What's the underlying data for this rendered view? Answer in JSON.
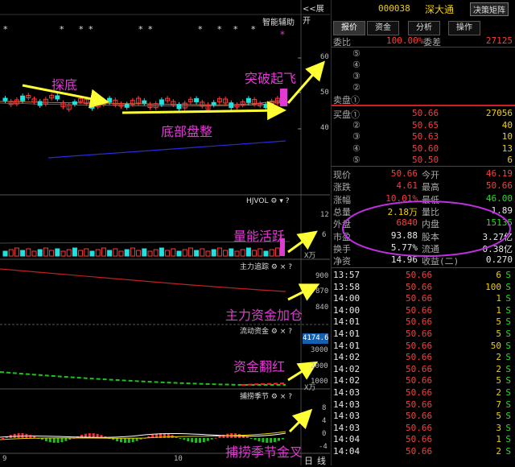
{
  "top_bar": {
    "expand_label": "<<展开",
    "code": "000038",
    "name": "深大通",
    "decision_button": "决策矩阵"
  },
  "main_chart": {
    "indicator_label": "智能辅助",
    "stars": [
      "*",
      "*",
      "*",
      "*",
      "*",
      "*",
      "*",
      "*",
      "*",
      "*"
    ],
    "price_ticks": [
      "60",
      "50",
      "40"
    ],
    "annotations": {
      "bottom_touch": "探底",
      "breakout": "突破起飞",
      "consolidation": "底部盘整"
    }
  },
  "volume_panel": {
    "title": "HJVOL",
    "ticks": [
      "12",
      "6",
      "X万"
    ],
    "annotation": "量能活跃"
  },
  "capital_panel": {
    "title": "主力追踪",
    "ticks": [
      "900",
      "870",
      "840"
    ],
    "annotation": "主力资金加仓"
  },
  "flow_panel": {
    "title": "流动资金",
    "value_box": "4174.6",
    "ticks": [
      "3000",
      "2000",
      "1000",
      "X万"
    ],
    "annotation": "资金翻红"
  },
  "season_panel": {
    "title": "捕捞季节",
    "ticks": [
      "8",
      "4",
      "0",
      "-4"
    ],
    "annotation": "捕捞季节金叉"
  },
  "x_axis": {
    "labels": [
      "9",
      "10"
    ],
    "period": "日",
    "line": "线"
  },
  "panel_icons": {
    "gear": "⚙",
    "down": "▾",
    "help": "?",
    "close": "×"
  },
  "tabs": [
    "报价",
    "资金",
    "分析",
    "操作"
  ],
  "order_book": {
    "commit_ratio_label": "委比",
    "commit_ratio": "100.00%",
    "commit_diff_label": "委差",
    "commit_diff": "27125",
    "sell_levels": [
      {
        "label": "⑤",
        "price": "",
        "vol": ""
      },
      {
        "label": "④",
        "price": "",
        "vol": ""
      },
      {
        "label": "③",
        "price": "",
        "vol": ""
      },
      {
        "label": "②",
        "price": "",
        "vol": ""
      },
      {
        "label": "卖盘①",
        "price": "",
        "vol": ""
      }
    ],
    "buy_levels": [
      {
        "label": "买盘①",
        "price": "50.66",
        "vol": "27056"
      },
      {
        "label": "②",
        "price": "50.65",
        "vol": "40"
      },
      {
        "label": "③",
        "price": "50.63",
        "vol": "10"
      },
      {
        "label": "④",
        "price": "50.60",
        "vol": "13"
      },
      {
        "label": "⑤",
        "price": "50.50",
        "vol": "6"
      }
    ]
  },
  "quote": [
    {
      "l1": "现价",
      "v1": "50.66",
      "c1": "red",
      "l2": "今开",
      "v2": "46.19",
      "c2": "red"
    },
    {
      "l1": "涨跌",
      "v1": "4.61",
      "c1": "red",
      "l2": "最高",
      "v2": "50.66",
      "c2": "red"
    },
    {
      "l1": "涨幅",
      "v1": "10.01%",
      "c1": "red",
      "l2": "最低",
      "v2": "46.00",
      "c2": "green"
    },
    {
      "l1": "总量",
      "v1": "2.18万",
      "c1": "yellow",
      "l2": "量比",
      "v2": "1.89",
      "c2": "white"
    },
    {
      "l1": "外盘",
      "v1": "6840",
      "c1": "red",
      "l2": "内盘",
      "v2": "15135",
      "c2": "green"
    },
    {
      "l1": "市盈",
      "v1": "93.88",
      "c1": "white",
      "l2": "股本",
      "v2": "3.27亿",
      "c2": "white"
    },
    {
      "l1": "换手",
      "v1": "5.77%",
      "c1": "white",
      "l2": "流通",
      "v2": "0.38亿",
      "c2": "white"
    },
    {
      "l1": "净资",
      "v1": "14.96",
      "c1": "white",
      "l2": "收益(二)",
      "v2": "0.270",
      "c2": "white"
    }
  ],
  "ticks_list": [
    {
      "time": "13:57",
      "price": "50.66",
      "vol": "6",
      "side": "S"
    },
    {
      "time": "13:58",
      "price": "50.66",
      "vol": "100",
      "side": "S"
    },
    {
      "time": "14:00",
      "price": "50.66",
      "vol": "1",
      "side": "S"
    },
    {
      "time": "14:00",
      "price": "50.66",
      "vol": "1",
      "side": "S"
    },
    {
      "time": "14:01",
      "price": "50.66",
      "vol": "5",
      "side": "S"
    },
    {
      "time": "14:01",
      "price": "50.66",
      "vol": "5",
      "side": "S"
    },
    {
      "time": "14:01",
      "price": "50.66",
      "vol": "50",
      "side": "S"
    },
    {
      "time": "14:02",
      "price": "50.66",
      "vol": "2",
      "side": "S"
    },
    {
      "time": "14:02",
      "price": "50.66",
      "vol": "2",
      "side": "S"
    },
    {
      "time": "14:02",
      "price": "50.66",
      "vol": "5",
      "side": "S"
    },
    {
      "time": "14:03",
      "price": "50.66",
      "vol": "2",
      "side": "S"
    },
    {
      "time": "14:03",
      "price": "50.66",
      "vol": "7",
      "side": "S"
    },
    {
      "time": "14:03",
      "price": "50.66",
      "vol": "5",
      "side": "S"
    },
    {
      "time": "14:03",
      "price": "50.66",
      "vol": "3",
      "side": "S"
    },
    {
      "time": "14:04",
      "price": "50.66",
      "vol": "1",
      "side": "S"
    },
    {
      "time": "14:04",
      "price": "50.66",
      "vol": "2",
      "side": "S"
    }
  ],
  "colors": {
    "annotation": "#e03ad2",
    "arrow": "#ffff33",
    "up": "#ff3b3b",
    "down": "#20e0e0",
    "highlight_circle": "#c030e0"
  }
}
